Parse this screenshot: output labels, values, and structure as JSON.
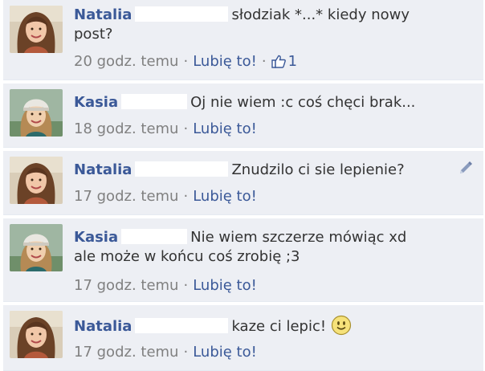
{
  "comments": [
    {
      "author": "Natalia",
      "text": "słodziak *...* kiedy nowy post?",
      "time": "20 godz. temu",
      "like_label": "Lubię to!",
      "like_count": "1"
    },
    {
      "author": "Kasia",
      "text": "Oj nie wiem :c coś chęci brak...",
      "time": "18 godz. temu",
      "like_label": "Lubię to!"
    },
    {
      "author": "Natalia",
      "text": "Znudzilo ci sie lepienie?",
      "time": "17 godz. temu",
      "like_label": "Lubię to!"
    },
    {
      "author": "Kasia",
      "text": "Nie wiem szczerze mówiąc xd ale może w końcu coś zrobię ;3",
      "time": "17 godz. temu",
      "like_label": "Lubię to!"
    },
    {
      "author": "Natalia",
      "text": "kaze ci lepic!",
      "time": "17 godz. temu",
      "like_label": "Lubię to!"
    }
  ],
  "separator": "·",
  "icons": {
    "like": "thumbs-up-icon",
    "edit": "pencil-icon",
    "emoji": "smiley-emoji-icon"
  },
  "colors": {
    "link": "#3b5998",
    "meta": "#808080",
    "comment_bg": "#edeff4"
  }
}
